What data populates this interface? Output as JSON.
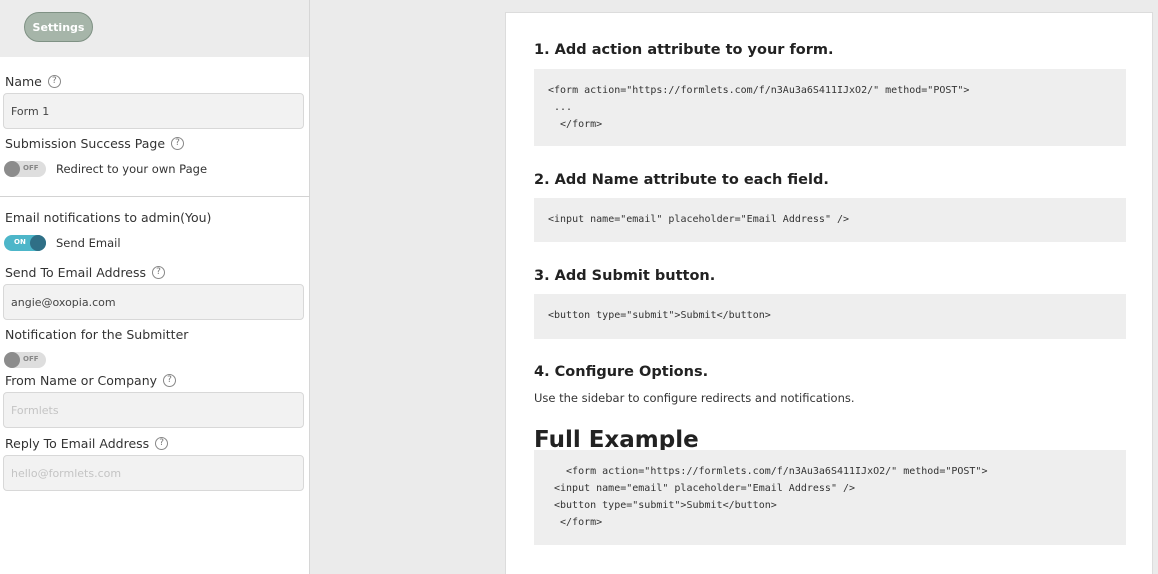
{
  "sidebar": {
    "settings_button": "Settings",
    "name_label": "Name",
    "name_value": "Form 1",
    "success_label": "Submission Success Page",
    "redirect_toggle": {
      "state": "OFF",
      "label": "Redirect to your own Page"
    },
    "email_admin_label": "Email notifications to admin(You)",
    "send_email_toggle": {
      "state": "ON",
      "label": "Send Email"
    },
    "send_to_label": "Send To Email Address",
    "send_to_value": "angie@oxopia.com",
    "submitter_label": "Notification for the Submitter",
    "submitter_toggle": {
      "state": "OFF"
    },
    "from_name_label": "From Name or Company",
    "from_name_placeholder": "Formlets",
    "reply_to_label": "Reply To Email Address",
    "reply_to_placeholder": "hello@formlets.com"
  },
  "main": {
    "step1": {
      "prefix": "1. Add ",
      "keyword": "action",
      "suffix": " attribute to your form.",
      "code": "<form action=\"https://formlets.com/f/n3Au3a6S411IJxO2/\" method=\"POST\">\n ...\n  </form>"
    },
    "step2": {
      "prefix": "2. Add ",
      "keyword": "Name",
      "suffix": " attribute to each field.",
      "code": "<input name=\"email\" placeholder=\"Email Address\" />"
    },
    "step3": {
      "title": "3. Add Submit button.",
      "code": "<button type=\"submit\">Submit</button>"
    },
    "step4": {
      "title": "4. Configure Options.",
      "desc": "Use the sidebar to configure redirects and notifications."
    },
    "full_example": {
      "title": "Full Example",
      "code": "  <form action=\"https://formlets.com/f/n3Au3a6S411IJxO2/\" method=\"POST\">\n<input name=\"email\" placeholder=\"Email Address\" />\n<button type=\"submit\">Submit</button>\n </form>"
    }
  },
  "colors": {
    "toggle_on": "#4db6c9",
    "settings_button": "#a6b5a9"
  }
}
